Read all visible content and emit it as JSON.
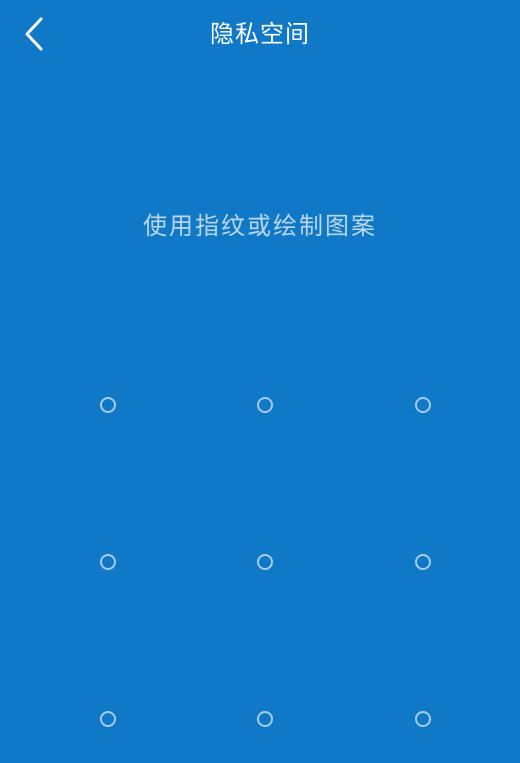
{
  "header": {
    "title": "隐私空间",
    "back_icon": "chevron-left-icon"
  },
  "main": {
    "instruction": "使用指纹或绘制图案"
  },
  "colors": {
    "background": "#0f79c7",
    "title": "#ffffff",
    "instruction": "#bcd6ee",
    "dot": "#a9cbea"
  }
}
